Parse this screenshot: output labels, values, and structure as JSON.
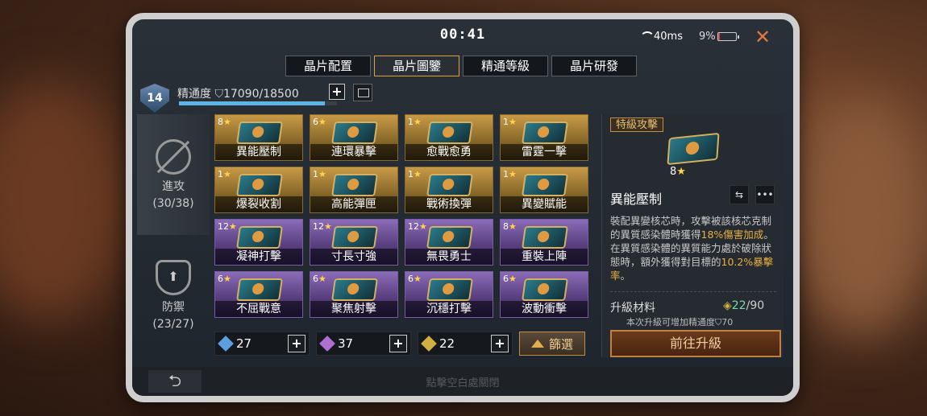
{
  "status": {
    "time": "00:41",
    "ping": "40ms",
    "battery": "9%",
    "close": "✕"
  },
  "tabs": [
    "晶片配置",
    "晶片圖鑒",
    "精通等級",
    "晶片研發"
  ],
  "mastery": {
    "level": "14",
    "label": "精通度",
    "value": "17090/18500",
    "progress": 0.924,
    "plus": "+"
  },
  "side": {
    "attack": {
      "label": "進攻",
      "count": "(30/38)"
    },
    "defense": {
      "label": "防禦",
      "count": "(23/27)"
    }
  },
  "chips": [
    {
      "stars": "8",
      "name": "異能壓制",
      "tier": "gold"
    },
    {
      "stars": "6",
      "name": "連環暴擊",
      "tier": "gold"
    },
    {
      "stars": "1",
      "name": "愈戰愈勇",
      "tier": "gold"
    },
    {
      "stars": "1",
      "name": "雷霆一擊",
      "tier": "gold"
    },
    {
      "stars": "1",
      "name": "爆裂收割",
      "tier": "gold"
    },
    {
      "stars": "1",
      "name": "高能彈匣",
      "tier": "gold"
    },
    {
      "stars": "1",
      "name": "戰術換彈",
      "tier": "gold"
    },
    {
      "stars": "1",
      "name": "異變賦能",
      "tier": "gold"
    },
    {
      "stars": "12",
      "name": "凝神打擊",
      "tier": "purple"
    },
    {
      "stars": "12",
      "name": "寸長寸強",
      "tier": "purple"
    },
    {
      "stars": "12",
      "name": "無畏勇士",
      "tier": "purple"
    },
    {
      "stars": "8",
      "name": "重裝上陣",
      "tier": "purple"
    },
    {
      "stars": "6",
      "name": "不屈戰意",
      "tier": "purple"
    },
    {
      "stars": "6",
      "name": "聚焦射擊",
      "tier": "purple"
    },
    {
      "stars": "6",
      "name": "沉穩打擊",
      "tier": "purple"
    },
    {
      "stars": "6",
      "name": "波動衝擊",
      "tier": "purple"
    }
  ],
  "resources": [
    {
      "value": "27",
      "color": "#5aa0e0"
    },
    {
      "value": "37",
      "color": "#b070d0"
    },
    {
      "value": "22",
      "color": "#d0b040"
    }
  ],
  "filter_label": "篩選",
  "detail": {
    "category": "特級攻擊",
    "stars": "8",
    "name": "異能壓制",
    "desc_1": "裝配異變核芯時，攻擊被該核芯克制的異質感染體時獲得",
    "desc_hl1": "18%傷害加成",
    "desc_2": "。在異質感染體的異質能力處於破除狀態時，額外獲得對目標的",
    "desc_hl2": "10.2%暴擊率",
    "desc_3": "。",
    "mat_label": "升級材料",
    "mat_have": "22",
    "mat_need": "/90",
    "mat_note_1": "本次升級可增加精通度",
    "mat_note_2": "70",
    "upgrade_label": "前往升級",
    "more": "•••"
  },
  "footer": {
    "back": "⮌",
    "hint": "點擊空白處關閉"
  },
  "colors": {
    "accent": "#e0a040",
    "progress": "#5fb4e6",
    "highlight": "#e8b040"
  }
}
